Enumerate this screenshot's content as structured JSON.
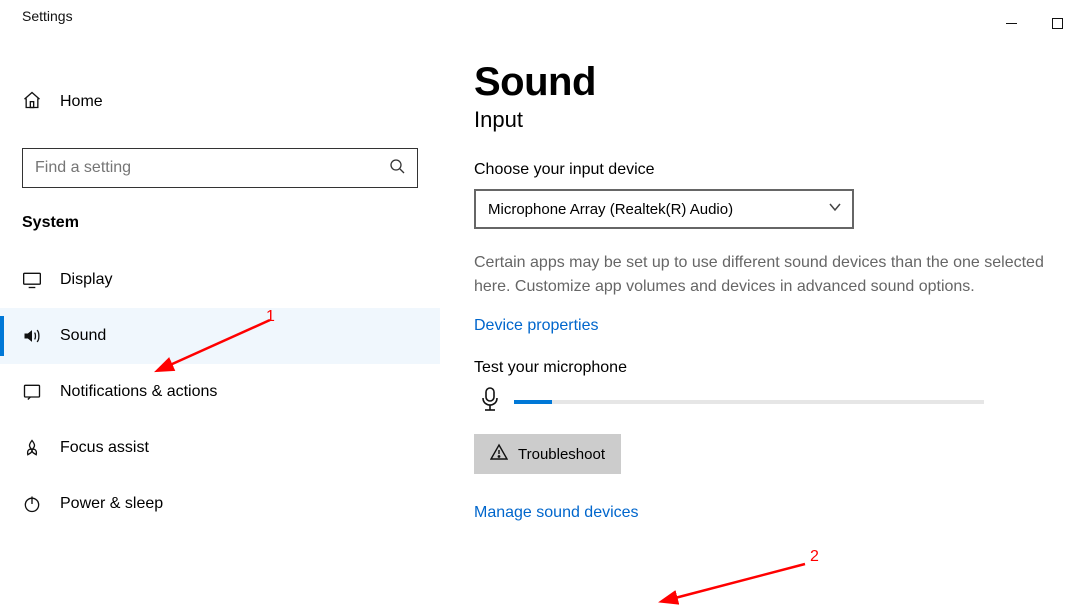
{
  "window": {
    "title": "Settings"
  },
  "sidebar": {
    "home_label": "Home",
    "search_placeholder": "Find a setting",
    "section_header": "System",
    "items": [
      {
        "label": "Display"
      },
      {
        "label": "Sound"
      },
      {
        "label": "Notifications & actions"
      },
      {
        "label": "Focus assist"
      },
      {
        "label": "Power & sleep"
      }
    ]
  },
  "page": {
    "title": "Sound",
    "subtitle": "Input",
    "choose_label": "Choose your input device",
    "dropdown_value": "Microphone Array (Realtek(R) Audio)",
    "help_text": "Certain apps may be set up to use different sound devices than the one selected here. Customize app volumes and devices in advanced sound options.",
    "device_props_link": "Device properties",
    "test_label": "Test your microphone",
    "progress_percent": 8,
    "troubleshoot_label": "Troubleshoot",
    "manage_link": "Manage sound devices"
  },
  "annotations": {
    "one": "1",
    "two": "2"
  }
}
